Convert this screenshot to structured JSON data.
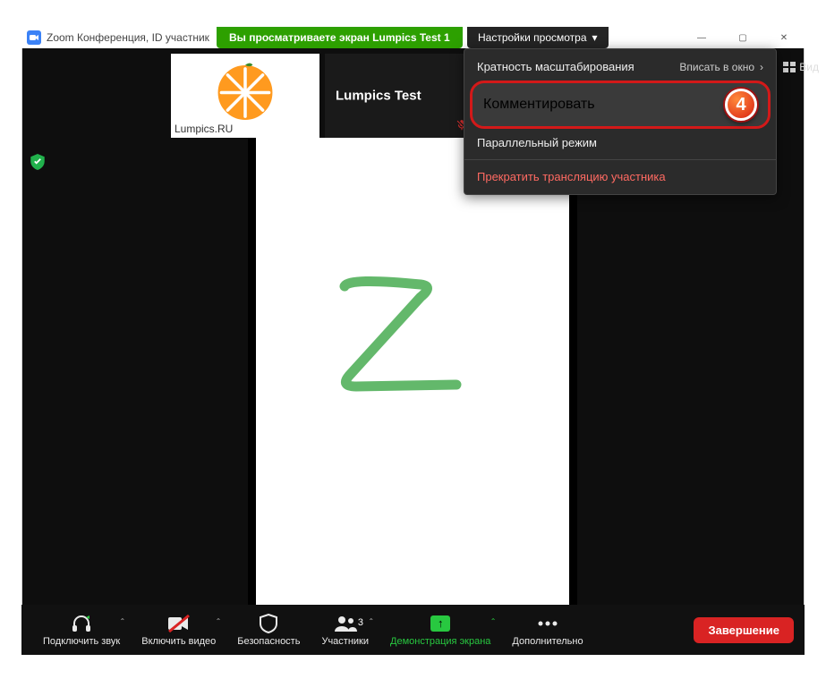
{
  "window": {
    "title": "Zoom Конференция, ID участник"
  },
  "banner": {
    "text": "Вы просматриваете экран Lumpics Test 1"
  },
  "view_settings": {
    "label": "Настройки просмотра"
  },
  "win": {
    "min": "—",
    "max": "▢",
    "close": "✕"
  },
  "thumbs": {
    "p1": {
      "name": "Lumpics.RU"
    },
    "p2": {
      "name": "Lumpics Test"
    }
  },
  "topright": {
    "view": "Вид"
  },
  "dropdown": {
    "zoom_label": "Кратность масштабирования",
    "zoom_value": "Вписать в окно",
    "annotate": "Комментировать",
    "sidebyside": "Параллельный режим",
    "stop": "Прекратить трансляцию участника",
    "step": "4"
  },
  "toolbar": {
    "audio": "Подключить звук",
    "video": "Включить видео",
    "security": "Безопасность",
    "participants": "Участники",
    "participants_count": "3",
    "share": "Демонстрация экрана",
    "more": "Дополнительно",
    "end": "Завершение"
  }
}
